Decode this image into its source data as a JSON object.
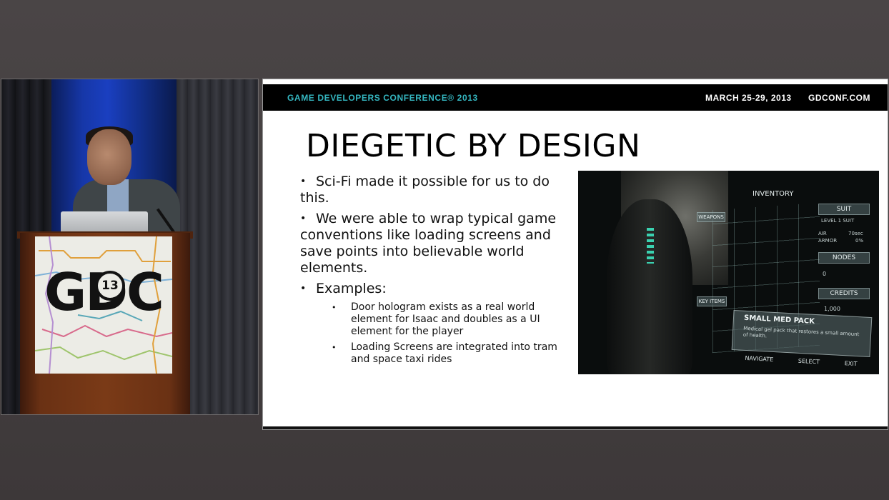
{
  "video": {
    "logo_text": "GDC",
    "logo_badge": "13"
  },
  "slide": {
    "banner": {
      "conference": "GAME DEVELOPERS CONFERENCE® 2013",
      "dates": "MARCH 25-29, 2013",
      "site": "GDCONF.COM"
    },
    "title": "DIEGETIC BY DESIGN",
    "bullets": [
      {
        "text": "Sci-Fi made it possible for us to do this."
      },
      {
        "text": "We were able to wrap typical game conventions like loading screens and save points into believable world elements."
      },
      {
        "text": "Examples:",
        "sub": [
          "Door hologram exists as a real world element for Isaac and doubles as a UI element for the player",
          "Loading Screens are integrated into tram and space taxi rides"
        ]
      }
    ],
    "bullet_glyph": "•"
  },
  "game_ui": {
    "inventory": "INVENTORY",
    "weapons": "WEAPONS",
    "key_items": "KEY ITEMS",
    "suit": "SUIT",
    "suit_level": "LEVEL 1 SUIT",
    "air": "AIR",
    "air_value": "70sec",
    "armor": "ARMOR",
    "armor_value": "0%",
    "nodes": "NODES",
    "nodes_value": "0",
    "credits": "CREDITS",
    "credits_value": "1,000",
    "medpack_title": "SMALL MED PACK",
    "medpack_desc": "Medical gel pack that restores a small amount of health.",
    "navigate": "NAVIGATE",
    "select": "SELECT",
    "exit": "EXIT",
    "colors": {
      "hologram": "#3de4c0",
      "panel": "#5a6e70"
    }
  }
}
